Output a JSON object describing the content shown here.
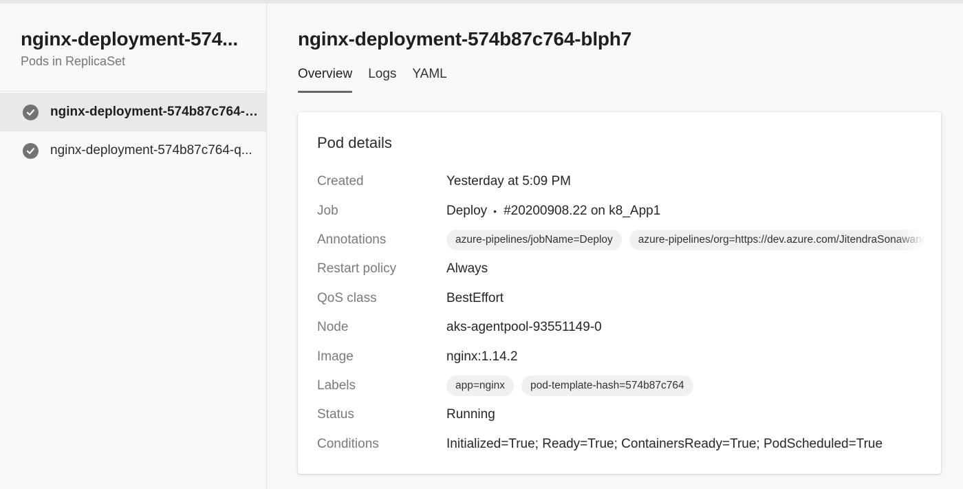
{
  "sidebar": {
    "title": "nginx-deployment-574...",
    "subtitle": "Pods in ReplicaSet",
    "items": [
      {
        "label": "nginx-deployment-574b87c764-b...",
        "icon": "check-circle-icon",
        "selected": true
      },
      {
        "label": "nginx-deployment-574b87c764-q...",
        "icon": "check-circle-icon",
        "selected": false
      }
    ]
  },
  "main": {
    "title": "nginx-deployment-574b87c764-blph7",
    "tabs": [
      {
        "label": "Overview",
        "active": true
      },
      {
        "label": "Logs",
        "active": false
      },
      {
        "label": "YAML",
        "active": false
      }
    ]
  },
  "pod_details": {
    "title": "Pod details",
    "created": {
      "label": "Created",
      "value": "Yesterday at 5:09 PM"
    },
    "job": {
      "label": "Job",
      "name": "Deploy",
      "separator": "•",
      "run": "#20200908.22 on k8_App1"
    },
    "annotations": {
      "label": "Annotations",
      "chips": [
        "azure-pipelines/jobName=Deploy",
        "azure-pipelines/org=https://dev.azure.com/JitendraSonawane"
      ]
    },
    "restart_policy": {
      "label": "Restart policy",
      "value": "Always"
    },
    "qos_class": {
      "label": "QoS class",
      "value": "BestEffort"
    },
    "node": {
      "label": "Node",
      "value": "aks-agentpool-93551149-0"
    },
    "image": {
      "label": "Image",
      "value": "nginx:1.14.2"
    },
    "labels": {
      "label": "Labels",
      "chips": [
        "app=nginx",
        "pod-template-hash=574b87c764"
      ]
    },
    "status": {
      "label": "Status",
      "value": "Running"
    },
    "conditions": {
      "label": "Conditions",
      "value": "Initialized=True; Ready=True; ContainersReady=True; PodScheduled=True"
    }
  },
  "colors": {
    "accent_underline": "#666666",
    "selected_row": "#e9e9e9",
    "check_icon": "#737373"
  }
}
